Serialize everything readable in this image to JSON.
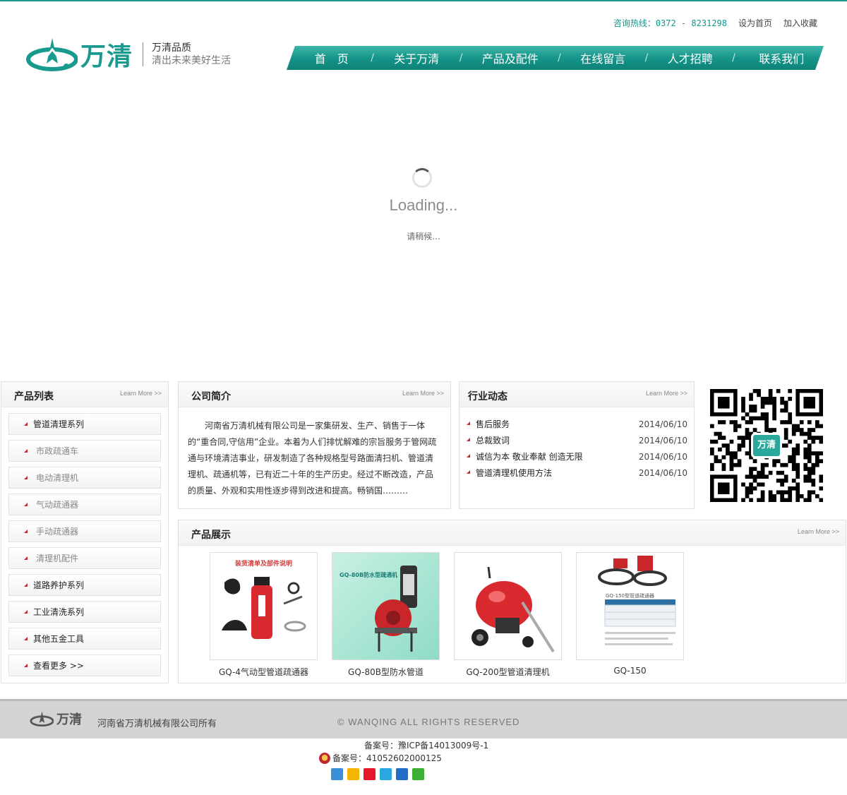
{
  "header": {
    "hotline": "咨询热线：0372 - 8231298",
    "set_home": "设为首页",
    "add_fav": "加入收藏",
    "brand": "万清",
    "slogan_line1": "万清品质",
    "slogan_line2": "清出未来美好生活"
  },
  "nav": {
    "items": [
      "首　页",
      "关于万清",
      "产品及配件",
      "在线留言",
      "人才招聘",
      "联系我们"
    ],
    "separator": "/"
  },
  "loading": {
    "title": "Loading...",
    "subtitle": "请稍候..."
  },
  "product_list": {
    "title": "产品列表",
    "more": "Learn More >>",
    "items": [
      {
        "label": "管道清理系列",
        "level": "main"
      },
      {
        "label": "市政疏通车",
        "level": "sub"
      },
      {
        "label": "电动清理机",
        "level": "sub"
      },
      {
        "label": "气动疏通器",
        "level": "sub"
      },
      {
        "label": "手动疏通器",
        "level": "sub"
      },
      {
        "label": "清理机配件",
        "level": "sub"
      },
      {
        "label": "道路养护系列",
        "level": "main"
      },
      {
        "label": "工业清洗系列",
        "level": "main"
      },
      {
        "label": "其他五金工具",
        "level": "main"
      },
      {
        "label": "查看更多 >>",
        "level": "main"
      }
    ]
  },
  "about": {
    "title": "公司简介",
    "more": "Learn More >>",
    "text": "河南省万清机械有限公司是一家集研发、生产、销售于一体的“重合同,守信用”企业。本着为人们排忧解难的宗旨服务于管网疏通与环境清洁事业，研发制造了各种规格型号路面清扫机、管道清理机、疏通机等，已有近二十年的生产历史。经过不断改造，产品的质量、外观和实用性逐步得到改进和提高。畅销国………"
  },
  "news": {
    "title": "行业动态",
    "more": "Learn More >>",
    "items": [
      {
        "title": "售后服务",
        "date": "2014/06/10"
      },
      {
        "title": "总裁致词",
        "date": "2014/06/10"
      },
      {
        "title": "诚信为本 敬业奉献 创造无限",
        "date": "2014/06/10"
      },
      {
        "title": "管道清理机使用方法",
        "date": "2014/06/10"
      }
    ]
  },
  "qr": {
    "badge": "万清"
  },
  "showcase": {
    "title": "产品展示",
    "more": "Learn More >>",
    "items": [
      {
        "name": "GQ-4气动型管道疏通器",
        "image_caption": "装货清单及部件说明"
      },
      {
        "name": "GQ-80B型防水管道",
        "image_caption": "GQ-80B防水型疏通机"
      },
      {
        "name": "GQ-200型管道清理机",
        "image_caption": ""
      },
      {
        "name": "GQ-150",
        "image_caption": "GQ-150型管道疏通器"
      }
    ]
  },
  "footer": {
    "brand": "万清",
    "company": "河南省万清机械有限公司所有",
    "rights": "© WANQING ALL RIGHTS RESERVED",
    "icp": "备案号：豫ICP备14013009号-1",
    "police": "备案号：41052602000125"
  },
  "colors": {
    "brand_teal": "#1a9a8e",
    "accent_red": "#c0282e"
  },
  "share_icons": [
    "plus-share-icon",
    "qzone-icon",
    "weibo-icon",
    "tencent-weibo-icon",
    "renren-icon",
    "wechat-icon"
  ]
}
